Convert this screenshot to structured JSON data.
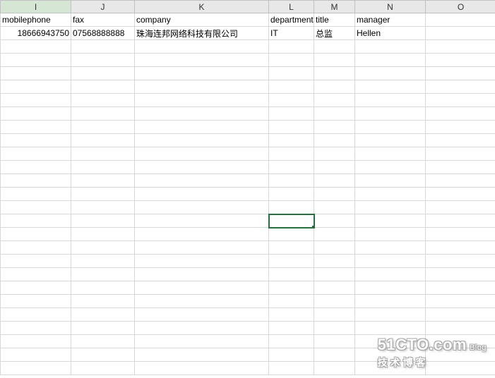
{
  "columns": [
    {
      "id": "I",
      "label": "I",
      "selected": true
    },
    {
      "id": "J",
      "label": "J",
      "selected": false
    },
    {
      "id": "K",
      "label": "K",
      "selected": false
    },
    {
      "id": "L",
      "label": "L",
      "selected": false
    },
    {
      "id": "M",
      "label": "M",
      "selected": false
    },
    {
      "id": "N",
      "label": "N",
      "selected": false
    },
    {
      "id": "O",
      "label": "O",
      "selected": false
    }
  ],
  "headers": {
    "I": "mobilephone",
    "J": "fax",
    "K": "company",
    "L": "department",
    "M": "title",
    "N": "manager",
    "O": ""
  },
  "row2": {
    "I": "18666943750",
    "J": "07568888888",
    "K": "珠海连邦网络科技有限公司",
    "L": "IT",
    "M": "总监",
    "N": "Hellen",
    "O": ""
  },
  "activeCell": "L16",
  "watermark": {
    "line1": "51CTO.com",
    "blog": "Blog",
    "line2": "技术博客"
  }
}
